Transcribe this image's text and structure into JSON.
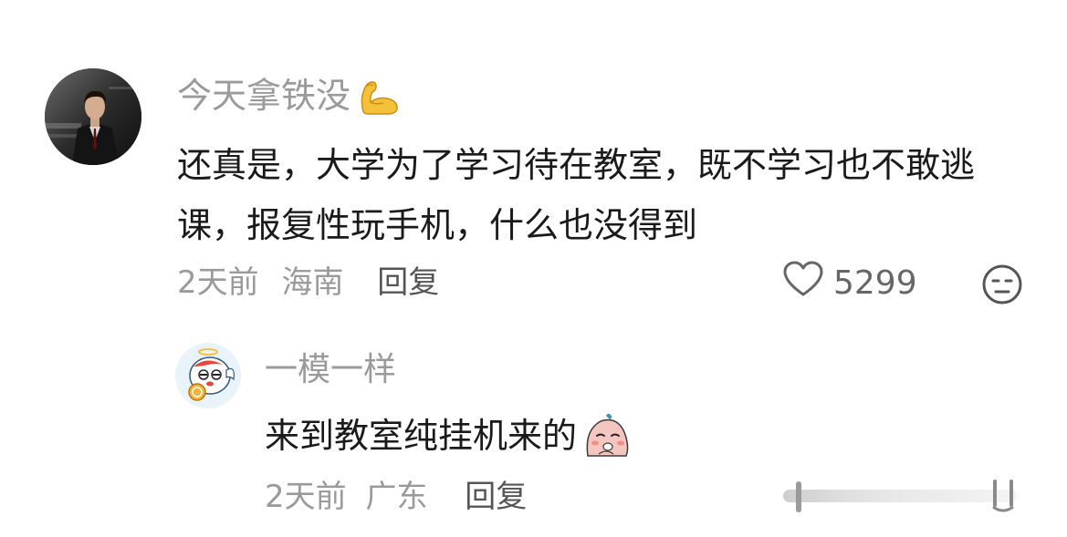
{
  "comments": [
    {
      "username": "今天拿铁没",
      "username_emoji": "flexed-biceps-emoji",
      "text": "还真是，大学为了学习待在教室，既不学习也不敢逃课，报复性玩手机，什么也没得到",
      "time": "2天前",
      "location": "海南",
      "reply_label": "回复",
      "likes": "5299",
      "like_icon": "heart-outline-icon",
      "dislike_icon": "unamused-face-icon"
    },
    {
      "username": "一模一样",
      "text": "来到教室纯挂机来的",
      "text_emoji": "tired-face-sticker",
      "time": "2天前",
      "location": "广东",
      "reply_label": "回复"
    }
  ],
  "colors": {
    "meta_gray": "#9a9a9a",
    "text_dark": "#1a1a1a",
    "reply_label": "#555555"
  }
}
